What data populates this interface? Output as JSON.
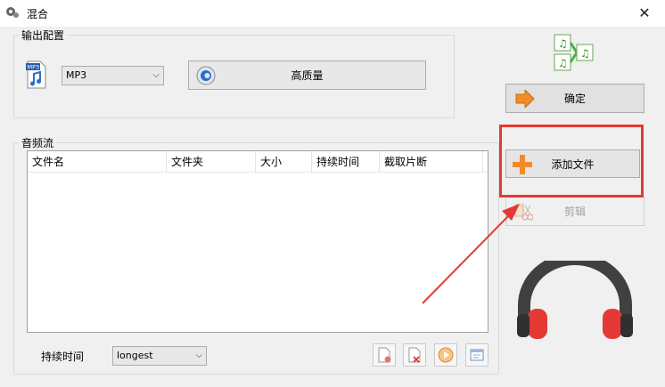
{
  "window": {
    "title": "混合",
    "close_glyph": "✕"
  },
  "output": {
    "group_label": "输出配置",
    "format_value": "MP3",
    "format_icon_text": "MP3",
    "quality_label": "高质量"
  },
  "actions": {
    "confirm_label": "确定",
    "add_file_label": "添加文件",
    "edit_label": "剪辑"
  },
  "streams": {
    "group_label": "音频流",
    "columns": [
      "文件名",
      "文件夹",
      "大小",
      "持续时间",
      "截取片断"
    ],
    "rows": []
  },
  "duration": {
    "label": "持续时间",
    "value": "longest"
  },
  "colors": {
    "highlight": "#e53935",
    "add_plus": "#f28c28",
    "headphone_cup": "#e53935"
  }
}
